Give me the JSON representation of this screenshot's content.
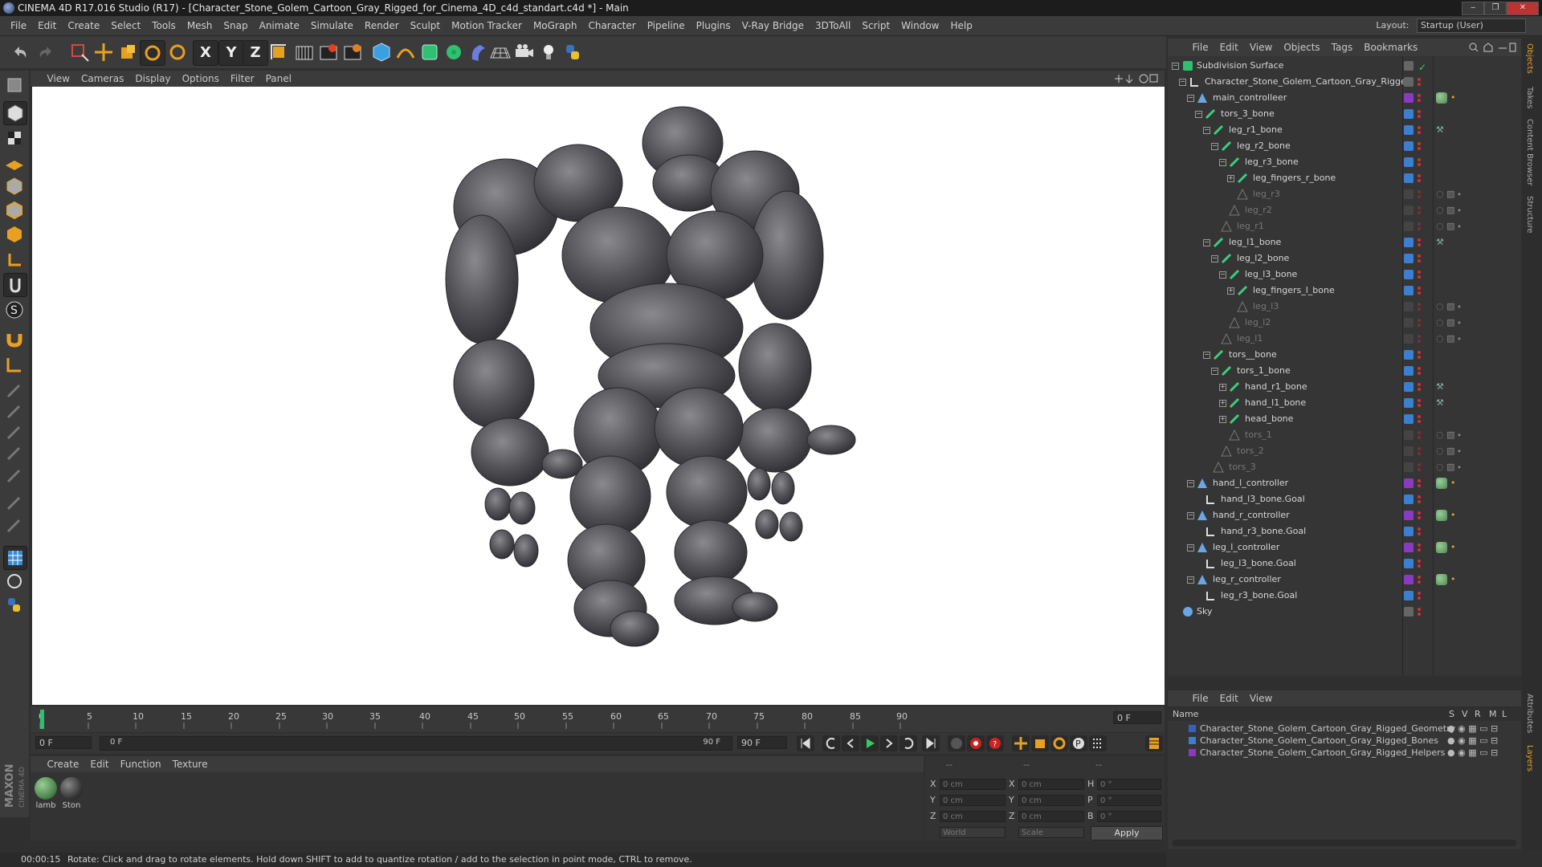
{
  "window": {
    "title": "CINEMA 4D R17.016 Studio (R17) - [Character_Stone_Golem_Cartoon_Gray_Rigged_for_Cinema_4D_c4d_standart.c4d *] - Main",
    "minimize": "‒",
    "maximize": "❐",
    "close": "✕"
  },
  "menu": [
    "File",
    "Edit",
    "Create",
    "Select",
    "Tools",
    "Mesh",
    "Snap",
    "Animate",
    "Simulate",
    "Render",
    "Sculpt",
    "Motion Tracker",
    "MoGraph",
    "Character",
    "Pipeline",
    "Plugins",
    "V-Ray Bridge",
    "3DToAll",
    "Script",
    "Window",
    "Help"
  ],
  "layout": {
    "label": "Layout:",
    "value": "Startup (User)"
  },
  "toolbar": {
    "x_label": "X",
    "y_label": "Y",
    "z_label": "Z"
  },
  "viewport_menu": [
    "View",
    "Cameras",
    "Display",
    "Options",
    "Filter",
    "Panel"
  ],
  "timeline": {
    "ticks": [
      "0",
      "5",
      "10",
      "15",
      "20",
      "25",
      "30",
      "35",
      "40",
      "45",
      "50",
      "55",
      "60",
      "65",
      "70",
      "75",
      "80",
      "85",
      "90"
    ],
    "current_frame": "0 F",
    "start_field": "0 F",
    "range_start": "0 F",
    "range_end": "90 F",
    "end_field": "90 F"
  },
  "material_menu": [
    "Create",
    "Edit",
    "Function",
    "Texture"
  ],
  "materials": [
    {
      "name": "lamb",
      "color": "#4f8a4f"
    },
    {
      "name": "Ston",
      "color": "#3b3b3b"
    }
  ],
  "coords": {
    "header1": "--",
    "header2": "--",
    "header3": "--",
    "x_label": "X",
    "y_label": "Y",
    "z_label": "Z",
    "h_label": "H",
    "p_label": "P",
    "b_label": "B",
    "pos_x": "0 cm",
    "pos_y": "0 cm",
    "pos_z": "0 cm",
    "size_x": "0 cm",
    "size_y": "0 cm",
    "size_z": "0 cm",
    "rot_h": "0 °",
    "rot_p": "0 °",
    "rot_b": "0 °",
    "mode1": "World",
    "mode2": "Scale",
    "apply": "Apply"
  },
  "status": {
    "time": "00:00:15",
    "message": "Rotate: Click and drag to rotate elements. Hold down SHIFT to add to quantize rotation / add to the selection in point mode, CTRL to remove."
  },
  "object_manager": {
    "menu": [
      "File",
      "Edit",
      "View",
      "Objects",
      "Tags",
      "Bookmarks"
    ],
    "rows": [
      {
        "name": "Subdivision Surface",
        "dim": false
      },
      {
        "name": "Character_Stone_Golem_Cartoon_Gray_Rigged",
        "dim": false
      },
      {
        "name": "main_controlleer",
        "dim": false
      },
      {
        "name": "tors_3_bone",
        "dim": false
      },
      {
        "name": "leg_r1_bone",
        "dim": false
      },
      {
        "name": "leg_r2_bone",
        "dim": false
      },
      {
        "name": "leg_r3_bone",
        "dim": false
      },
      {
        "name": "leg_fingers_r_bone",
        "dim": false
      },
      {
        "name": "leg_r3",
        "dim": true
      },
      {
        "name": "leg_r2",
        "dim": true
      },
      {
        "name": "leg_r1",
        "dim": true
      },
      {
        "name": "leg_l1_bone",
        "dim": false
      },
      {
        "name": "leg_l2_bone",
        "dim": false
      },
      {
        "name": "leg_l3_bone",
        "dim": false
      },
      {
        "name": "leg_fingers_l_bone",
        "dim": false
      },
      {
        "name": "leg_l3",
        "dim": true
      },
      {
        "name": "leg_l2",
        "dim": true
      },
      {
        "name": "leg_l1",
        "dim": true
      },
      {
        "name": "tors__bone",
        "dim": false
      },
      {
        "name": "tors_1_bone",
        "dim": false
      },
      {
        "name": "hand_r1_bone",
        "dim": false
      },
      {
        "name": "hand_l1_bone",
        "dim": false
      },
      {
        "name": "head_bone",
        "dim": false
      },
      {
        "name": "tors_1",
        "dim": true
      },
      {
        "name": "tors_2",
        "dim": true
      },
      {
        "name": "tors_3",
        "dim": true
      },
      {
        "name": "hand_l_controller",
        "dim": false
      },
      {
        "name": "hand_l3_bone.Goal",
        "dim": false
      },
      {
        "name": "hand_r_controller",
        "dim": false
      },
      {
        "name": "hand_r3_bone.Goal",
        "dim": false
      },
      {
        "name": "leg_l_controller",
        "dim": false
      },
      {
        "name": "leg_l3_bone.Goal",
        "dim": false
      },
      {
        "name": "leg_r_controller",
        "dim": false
      },
      {
        "name": "leg_r3_bone.Goal",
        "dim": false
      },
      {
        "name": "Sky",
        "dim": false
      }
    ]
  },
  "layers": {
    "menu": [
      "File",
      "Edit",
      "View"
    ],
    "header": {
      "name": "Name",
      "s": "S",
      "v": "V",
      "r": "R",
      "m": "M",
      "l": "L"
    },
    "items": [
      {
        "name": "Character_Stone_Golem_Cartoon_Gray_Rigged_Geometry",
        "color": "#3a5fbf"
      },
      {
        "name": "Character_Stone_Golem_Cartoon_Gray_Rigged_Bones",
        "color": "#3a7fd0"
      },
      {
        "name": "Character_Stone_Golem_Cartoon_Gray_Rigged_Helpers",
        "color": "#8a3ac0"
      }
    ]
  },
  "side_tabs": [
    "Objects",
    "Takes",
    "Content Browser",
    "Structure",
    "Attributes",
    "Layers"
  ],
  "logo": {
    "line1": "MAXON",
    "line2": "CINEMA 4D"
  }
}
